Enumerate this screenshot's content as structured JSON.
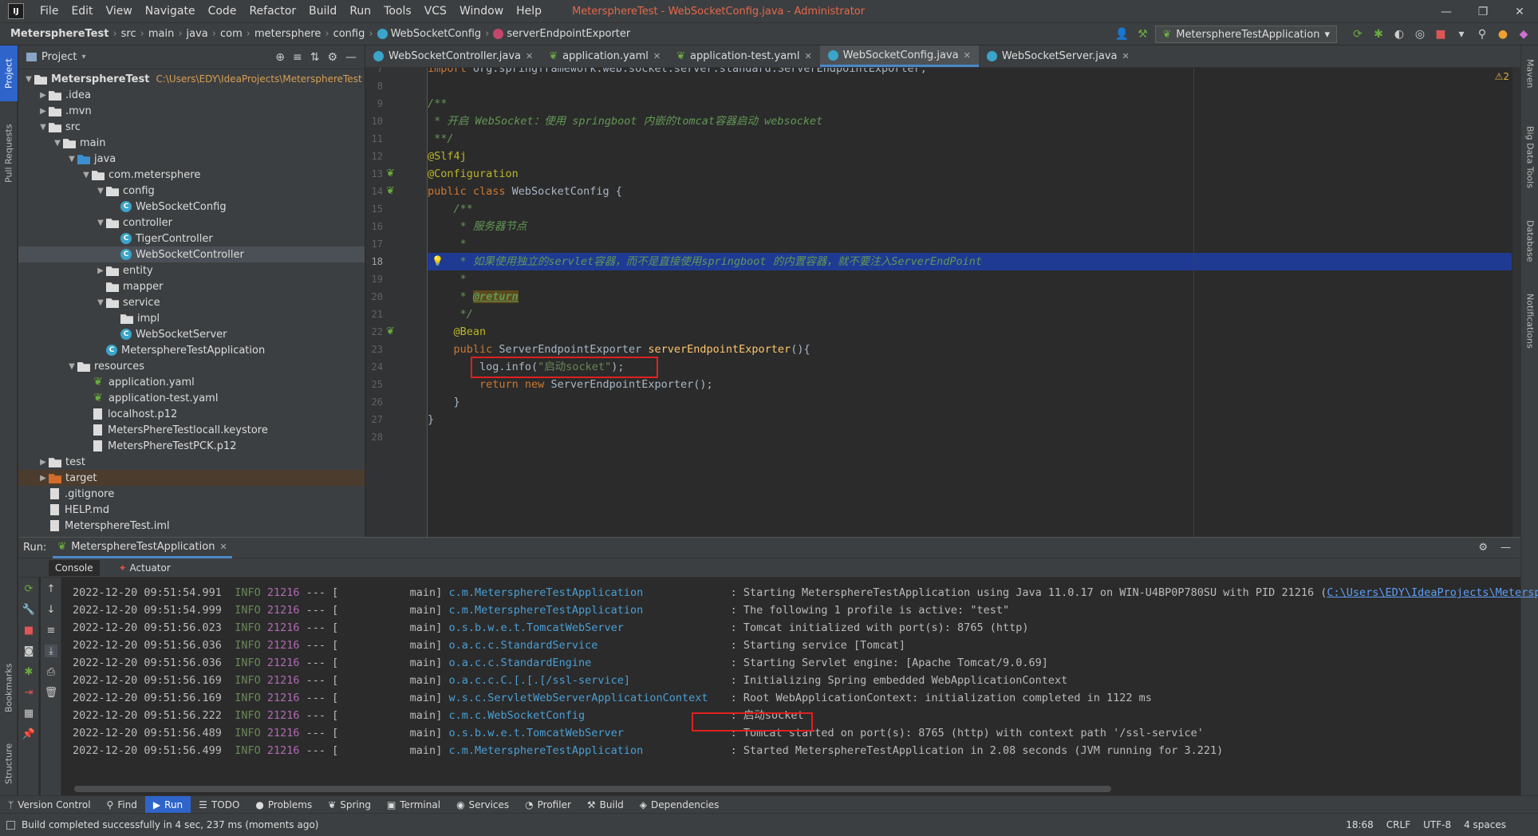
{
  "app": {
    "logo": "IJ",
    "title": "MetersphereTest - WebSocketConfig.java - Administrator",
    "menu": [
      "File",
      "Edit",
      "View",
      "Navigate",
      "Code",
      "Refactor",
      "Build",
      "Run",
      "Tools",
      "VCS",
      "Window",
      "Help"
    ],
    "window_controls": [
      "—",
      "❐",
      "✕"
    ]
  },
  "breadcrumb": [
    "MetersphereTest",
    "src",
    "main",
    "java",
    "com",
    "metersphere",
    "config",
    "WebSocketConfig",
    "serverEndpointExporter"
  ],
  "run_config": {
    "label": "MetersphereTestApplication",
    "arrow": "▾"
  },
  "left_strip": [
    "Project",
    "Pull Requests",
    "Bookmarks",
    "Structure"
  ],
  "right_strip": [
    "Maven",
    "Big Data Tools",
    "Database",
    "Notifications"
  ],
  "project_panel": {
    "title": "Project",
    "tools": [
      "⊕",
      "≡",
      "⇅",
      "⚙",
      "—"
    ],
    "tree": [
      {
        "depth": 0,
        "arrow": "▼",
        "icon": "folder",
        "label": "MetersphereTest",
        "path": "C:\\Users\\EDY\\IdeaProjects\\MetersphereTest"
      },
      {
        "depth": 1,
        "arrow": "▶",
        "icon": "folder",
        "label": ".idea"
      },
      {
        "depth": 1,
        "arrow": "▶",
        "icon": "folder",
        "label": ".mvn"
      },
      {
        "depth": 1,
        "arrow": "▼",
        "icon": "folder",
        "label": "src"
      },
      {
        "depth": 2,
        "arrow": "▼",
        "icon": "folder",
        "label": "main"
      },
      {
        "depth": 3,
        "arrow": "▼",
        "icon": "folder blue",
        "label": "java"
      },
      {
        "depth": 4,
        "arrow": "▼",
        "icon": "pkg",
        "label": "com.metersphere"
      },
      {
        "depth": 5,
        "arrow": "▼",
        "icon": "pkg",
        "label": "config"
      },
      {
        "depth": 6,
        "arrow": "",
        "icon": "cls",
        "label": "WebSocketConfig"
      },
      {
        "depth": 5,
        "arrow": "▼",
        "icon": "pkg",
        "label": "controller"
      },
      {
        "depth": 6,
        "arrow": "",
        "icon": "cls",
        "label": "TigerController"
      },
      {
        "depth": 6,
        "arrow": "",
        "icon": "cls",
        "label": "WebSocketController",
        "selected": true
      },
      {
        "depth": 5,
        "arrow": "▶",
        "icon": "pkg",
        "label": "entity"
      },
      {
        "depth": 5,
        "arrow": "",
        "icon": "pkg",
        "label": "mapper"
      },
      {
        "depth": 5,
        "arrow": "▼",
        "icon": "pkg",
        "label": "service"
      },
      {
        "depth": 6,
        "arrow": "",
        "icon": "pkg",
        "label": "impl"
      },
      {
        "depth": 6,
        "arrow": "",
        "icon": "cls",
        "label": "WebSocketServer"
      },
      {
        "depth": 5,
        "arrow": "",
        "icon": "cls",
        "label": "MetersphereTestApplication"
      },
      {
        "depth": 3,
        "arrow": "▼",
        "icon": "folder",
        "label": "resources"
      },
      {
        "depth": 4,
        "arrow": "",
        "icon": "yaml",
        "label": "application.yaml"
      },
      {
        "depth": 4,
        "arrow": "",
        "icon": "yaml",
        "label": "application-test.yaml"
      },
      {
        "depth": 4,
        "arrow": "",
        "icon": "file",
        "label": "localhost.p12"
      },
      {
        "depth": 4,
        "arrow": "",
        "icon": "file",
        "label": "MetersPhereTestlocall.keystore"
      },
      {
        "depth": 4,
        "arrow": "",
        "icon": "file",
        "label": "MetersPhereTestPCK.p12"
      },
      {
        "depth": 1,
        "arrow": "▶",
        "icon": "folder",
        "label": "test"
      },
      {
        "depth": 1,
        "arrow": "▶",
        "icon": "folder orange",
        "label": "target",
        "highlight": true
      },
      {
        "depth": 1,
        "arrow": "",
        "icon": "file",
        "label": ".gitignore"
      },
      {
        "depth": 1,
        "arrow": "",
        "icon": "file",
        "label": "HELP.md"
      },
      {
        "depth": 1,
        "arrow": "",
        "icon": "file",
        "label": "MetersphereTest.iml"
      }
    ]
  },
  "editor_tabs": [
    {
      "label": "WebSocketController.java",
      "type": "java"
    },
    {
      "label": "application.yaml",
      "type": "yaml"
    },
    {
      "label": "application-test.yaml",
      "type": "yaml"
    },
    {
      "label": "WebSocketConfig.java",
      "type": "java",
      "active": true
    },
    {
      "label": "WebSocketServer.java",
      "type": "java"
    }
  ],
  "editor": {
    "warning_badge": "⚠2",
    "current_line": 18,
    "lines": [
      {
        "n": 7,
        "html": "<span class=\"kw\">import</span> org.springframework.web.socket.server.standard.ServerEndpointExporter;"
      },
      {
        "n": 8,
        "html": ""
      },
      {
        "n": 9,
        "html": "<span class=\"cmt\">/**</span>"
      },
      {
        "n": 10,
        "html": "<span class=\"cmt\"> * 开启 WebSocket：使用 springboot 内嵌的tomcat容器启动 websocket</span>"
      },
      {
        "n": 11,
        "html": "<span class=\"cmt\"> **/</span>"
      },
      {
        "n": 12,
        "html": "<span class=\"ann\">@Slf4j</span>"
      },
      {
        "n": 13,
        "html": "<span class=\"ann\">@Configuration</span>"
      },
      {
        "n": 14,
        "html": "<span class=\"kw\">public class</span> WebSocketConfig {"
      },
      {
        "n": 15,
        "html": "    <span class=\"cmt\">/**</span>"
      },
      {
        "n": 16,
        "html": "<span class=\"cmt\">     * 服务器节点</span>"
      },
      {
        "n": 17,
        "html": "<span class=\"cmt\">     *</span>"
      },
      {
        "n": 18,
        "html": "<span class=\"cmt\">     * 如果使用独立的servlet容器，而不是直接使用springboot 的内置容器，就不要注入ServerEndPoint</span>"
      },
      {
        "n": 19,
        "html": "<span class=\"cmt\">     *</span>"
      },
      {
        "n": 20,
        "html": "<span class=\"cmt\">     * <b style=\"color:#629755;background:#5c4a1c;text-decoration:underline\">@return</b></span>"
      },
      {
        "n": 21,
        "html": "<span class=\"cmt\">     */</span>"
      },
      {
        "n": 22,
        "html": "    <span class=\"ann\">@Bean</span>"
      },
      {
        "n": 23,
        "html": "    <span class=\"kw\">public</span> ServerEndpointExporter <span class=\"fn\">serverEndpointExporter</span>(){"
      },
      {
        "n": 24,
        "html": "        log.info(<span class=\"str\">\"启动socket\"</span>);"
      },
      {
        "n": 25,
        "html": "        <span class=\"kw\">return new</span> ServerEndpointExporter();"
      },
      {
        "n": 26,
        "html": "    }"
      },
      {
        "n": 27,
        "html": "}"
      },
      {
        "n": 28,
        "html": ""
      }
    ]
  },
  "run": {
    "label": "Run:",
    "tab": "MetersphereTestApplication",
    "subtabs": [
      "Console",
      "Actuator"
    ],
    "logs": [
      {
        "ts": "2022-12-20 09:51:54.991",
        "lvl": "INFO",
        "pid": "21216",
        "thr": "main",
        "logger": "c.m.MetersphereTestApplication",
        "msg": "Starting MetersphereTestApplication using Java 11.0.17 on WIN-U4BP0P780SU with PID 21216 (",
        "link": "C:\\Users\\EDY\\IdeaProjects\\Metersphe"
      },
      {
        "ts": "2022-12-20 09:51:54.999",
        "lvl": "INFO",
        "pid": "21216",
        "thr": "main",
        "logger": "c.m.MetersphereTestApplication",
        "msg": "The following 1 profile is active: \"test\""
      },
      {
        "ts": "2022-12-20 09:51:56.023",
        "lvl": "INFO",
        "pid": "21216",
        "thr": "main",
        "logger": "o.s.b.w.e.t.TomcatWebServer",
        "msg": "Tomcat initialized with port(s): 8765 (http)"
      },
      {
        "ts": "2022-12-20 09:51:56.036",
        "lvl": "INFO",
        "pid": "21216",
        "thr": "main",
        "logger": "o.a.c.c.StandardService",
        "msg": "Starting service [Tomcat]"
      },
      {
        "ts": "2022-12-20 09:51:56.036",
        "lvl": "INFO",
        "pid": "21216",
        "thr": "main",
        "logger": "o.a.c.c.StandardEngine",
        "msg": "Starting Servlet engine: [Apache Tomcat/9.0.69]"
      },
      {
        "ts": "2022-12-20 09:51:56.169",
        "lvl": "INFO",
        "pid": "21216",
        "thr": "main",
        "logger": "o.a.c.c.C.[.[.[/ssl-service]",
        "msg": "Initializing Spring embedded WebApplicationContext"
      },
      {
        "ts": "2022-12-20 09:51:56.169",
        "lvl": "INFO",
        "pid": "21216",
        "thr": "main",
        "logger": "w.s.c.ServletWebServerApplicationContext",
        "msg": "Root WebApplicationContext: initialization completed in 1122 ms"
      },
      {
        "ts": "2022-12-20 09:51:56.222",
        "lvl": "INFO",
        "pid": "21216",
        "thr": "main",
        "logger": "c.m.c.WebSocketConfig",
        "msg": "启动socket"
      },
      {
        "ts": "2022-12-20 09:51:56.489",
        "lvl": "INFO",
        "pid": "21216",
        "thr": "main",
        "logger": "o.s.b.w.e.t.TomcatWebServer",
        "msg": "Tomcat started on port(s): 8765 (http) with context path '/ssl-service'"
      },
      {
        "ts": "2022-12-20 09:51:56.499",
        "lvl": "INFO",
        "pid": "21216",
        "thr": "main",
        "logger": "c.m.MetersphereTestApplication",
        "msg": "Started MetersphereTestApplication in 2.08 seconds (JVM running for 3.221)"
      }
    ]
  },
  "bottom_tools": [
    {
      "label": "Version Control",
      "icon": "ᛘ"
    },
    {
      "label": "Find",
      "icon": "⚲"
    },
    {
      "label": "Run",
      "icon": "▶",
      "active": true
    },
    {
      "label": "TODO",
      "icon": "☰"
    },
    {
      "label": "Problems",
      "icon": "●"
    },
    {
      "label": "Spring",
      "icon": "❦"
    },
    {
      "label": "Terminal",
      "icon": "▣"
    },
    {
      "label": "Services",
      "icon": "◉"
    },
    {
      "label": "Profiler",
      "icon": "◔"
    },
    {
      "label": "Build",
      "icon": "⚒"
    },
    {
      "label": "Dependencies",
      "icon": "◈"
    }
  ],
  "status": {
    "message": "Build completed successfully in 4 sec, 237 ms (moments ago)",
    "position": "18:68",
    "line_sep": "CRLF",
    "encoding": "UTF-8",
    "indent": "4 spaces"
  }
}
